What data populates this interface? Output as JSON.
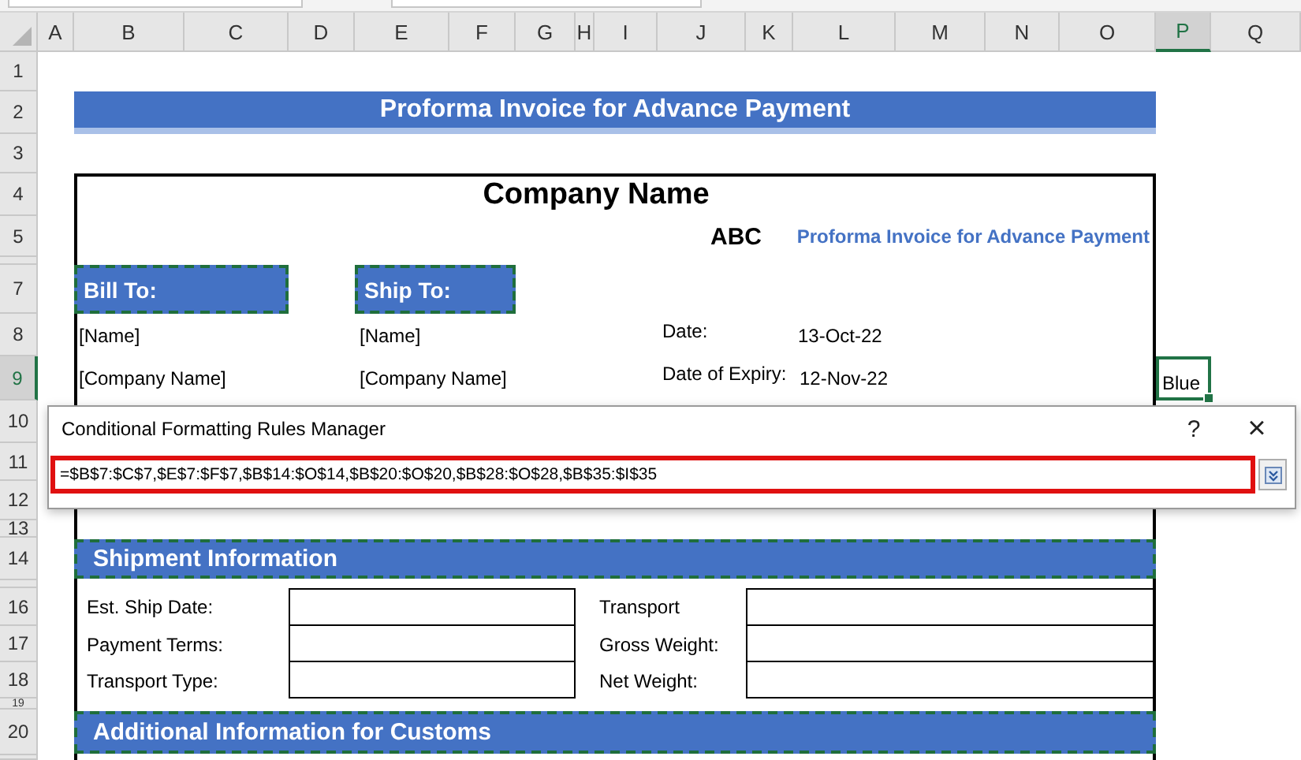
{
  "column_headers": [
    {
      "label": "A",
      "selected": false
    },
    {
      "label": "B",
      "selected": false
    },
    {
      "label": "C",
      "selected": false
    },
    {
      "label": "D",
      "selected": false
    },
    {
      "label": "E",
      "selected": false
    },
    {
      "label": "F",
      "selected": false
    },
    {
      "label": "G",
      "selected": false
    },
    {
      "label": "H",
      "selected": false
    },
    {
      "label": "I",
      "selected": false
    },
    {
      "label": "J",
      "selected": false
    },
    {
      "label": "K",
      "selected": false
    },
    {
      "label": "L",
      "selected": false
    },
    {
      "label": "M",
      "selected": false
    },
    {
      "label": "N",
      "selected": false
    },
    {
      "label": "O",
      "selected": false
    },
    {
      "label": "P",
      "selected": true
    },
    {
      "label": "Q",
      "selected": false
    }
  ],
  "row_headers": [
    {
      "label": "1",
      "selected": false
    },
    {
      "label": "2",
      "selected": false
    },
    {
      "label": "3",
      "selected": false
    },
    {
      "label": "4",
      "selected": false
    },
    {
      "label": "5",
      "selected": false
    },
    {
      "label": "7",
      "selected": false
    },
    {
      "label": "8",
      "selected": false
    },
    {
      "label": "9",
      "selected": true
    },
    {
      "label": "10",
      "selected": false
    },
    {
      "label": "11",
      "selected": false
    },
    {
      "label": "12",
      "selected": false
    },
    {
      "label": "13",
      "selected": false
    },
    {
      "label": "14",
      "selected": false
    },
    {
      "label": "16",
      "selected": false
    },
    {
      "label": "17",
      "selected": false
    },
    {
      "label": "18",
      "selected": false
    },
    {
      "label": "19",
      "selected": false
    },
    {
      "label": "20",
      "selected": false
    }
  ],
  "sheet": {
    "title_banner": "Proforma Invoice for Advance Payment",
    "company_name": "Company Name",
    "company_value": "ABC",
    "subtitle": "Proforma Invoice for Advance Payment",
    "bill_to": {
      "heading": "Bill To:",
      "name": "[Name]",
      "company": "[Company Name]"
    },
    "ship_to": {
      "heading": "Ship To:",
      "name": "[Name]",
      "company": "[Company Name]"
    },
    "date_label": "Date:",
    "date_value": "13-Oct-22",
    "expiry_label": "Date of Expiry:",
    "expiry_value": "12-Nov-22",
    "active_cell": {
      "value": "Blue"
    },
    "shipment": {
      "heading": "Shipment Information",
      "left_fields": [
        {
          "label": "Est. Ship Date:"
        },
        {
          "label": "Payment Terms:"
        },
        {
          "label": "Transport Type:"
        }
      ],
      "right_fields": [
        {
          "label": "Transport"
        },
        {
          "label": "Gross Weight:"
        },
        {
          "label": "Net Weight:"
        }
      ]
    },
    "customs_heading": "Additional Information for Customs"
  },
  "dialog": {
    "title": "Conditional Formatting Rules Manager",
    "help": "?",
    "close": "×",
    "range_value": "=$B$7:$C$7,$E$7:$F$7,$B$14:$O$14,$B$20:$O$20,$B$28:$O$28,$B$35:$I$35"
  }
}
